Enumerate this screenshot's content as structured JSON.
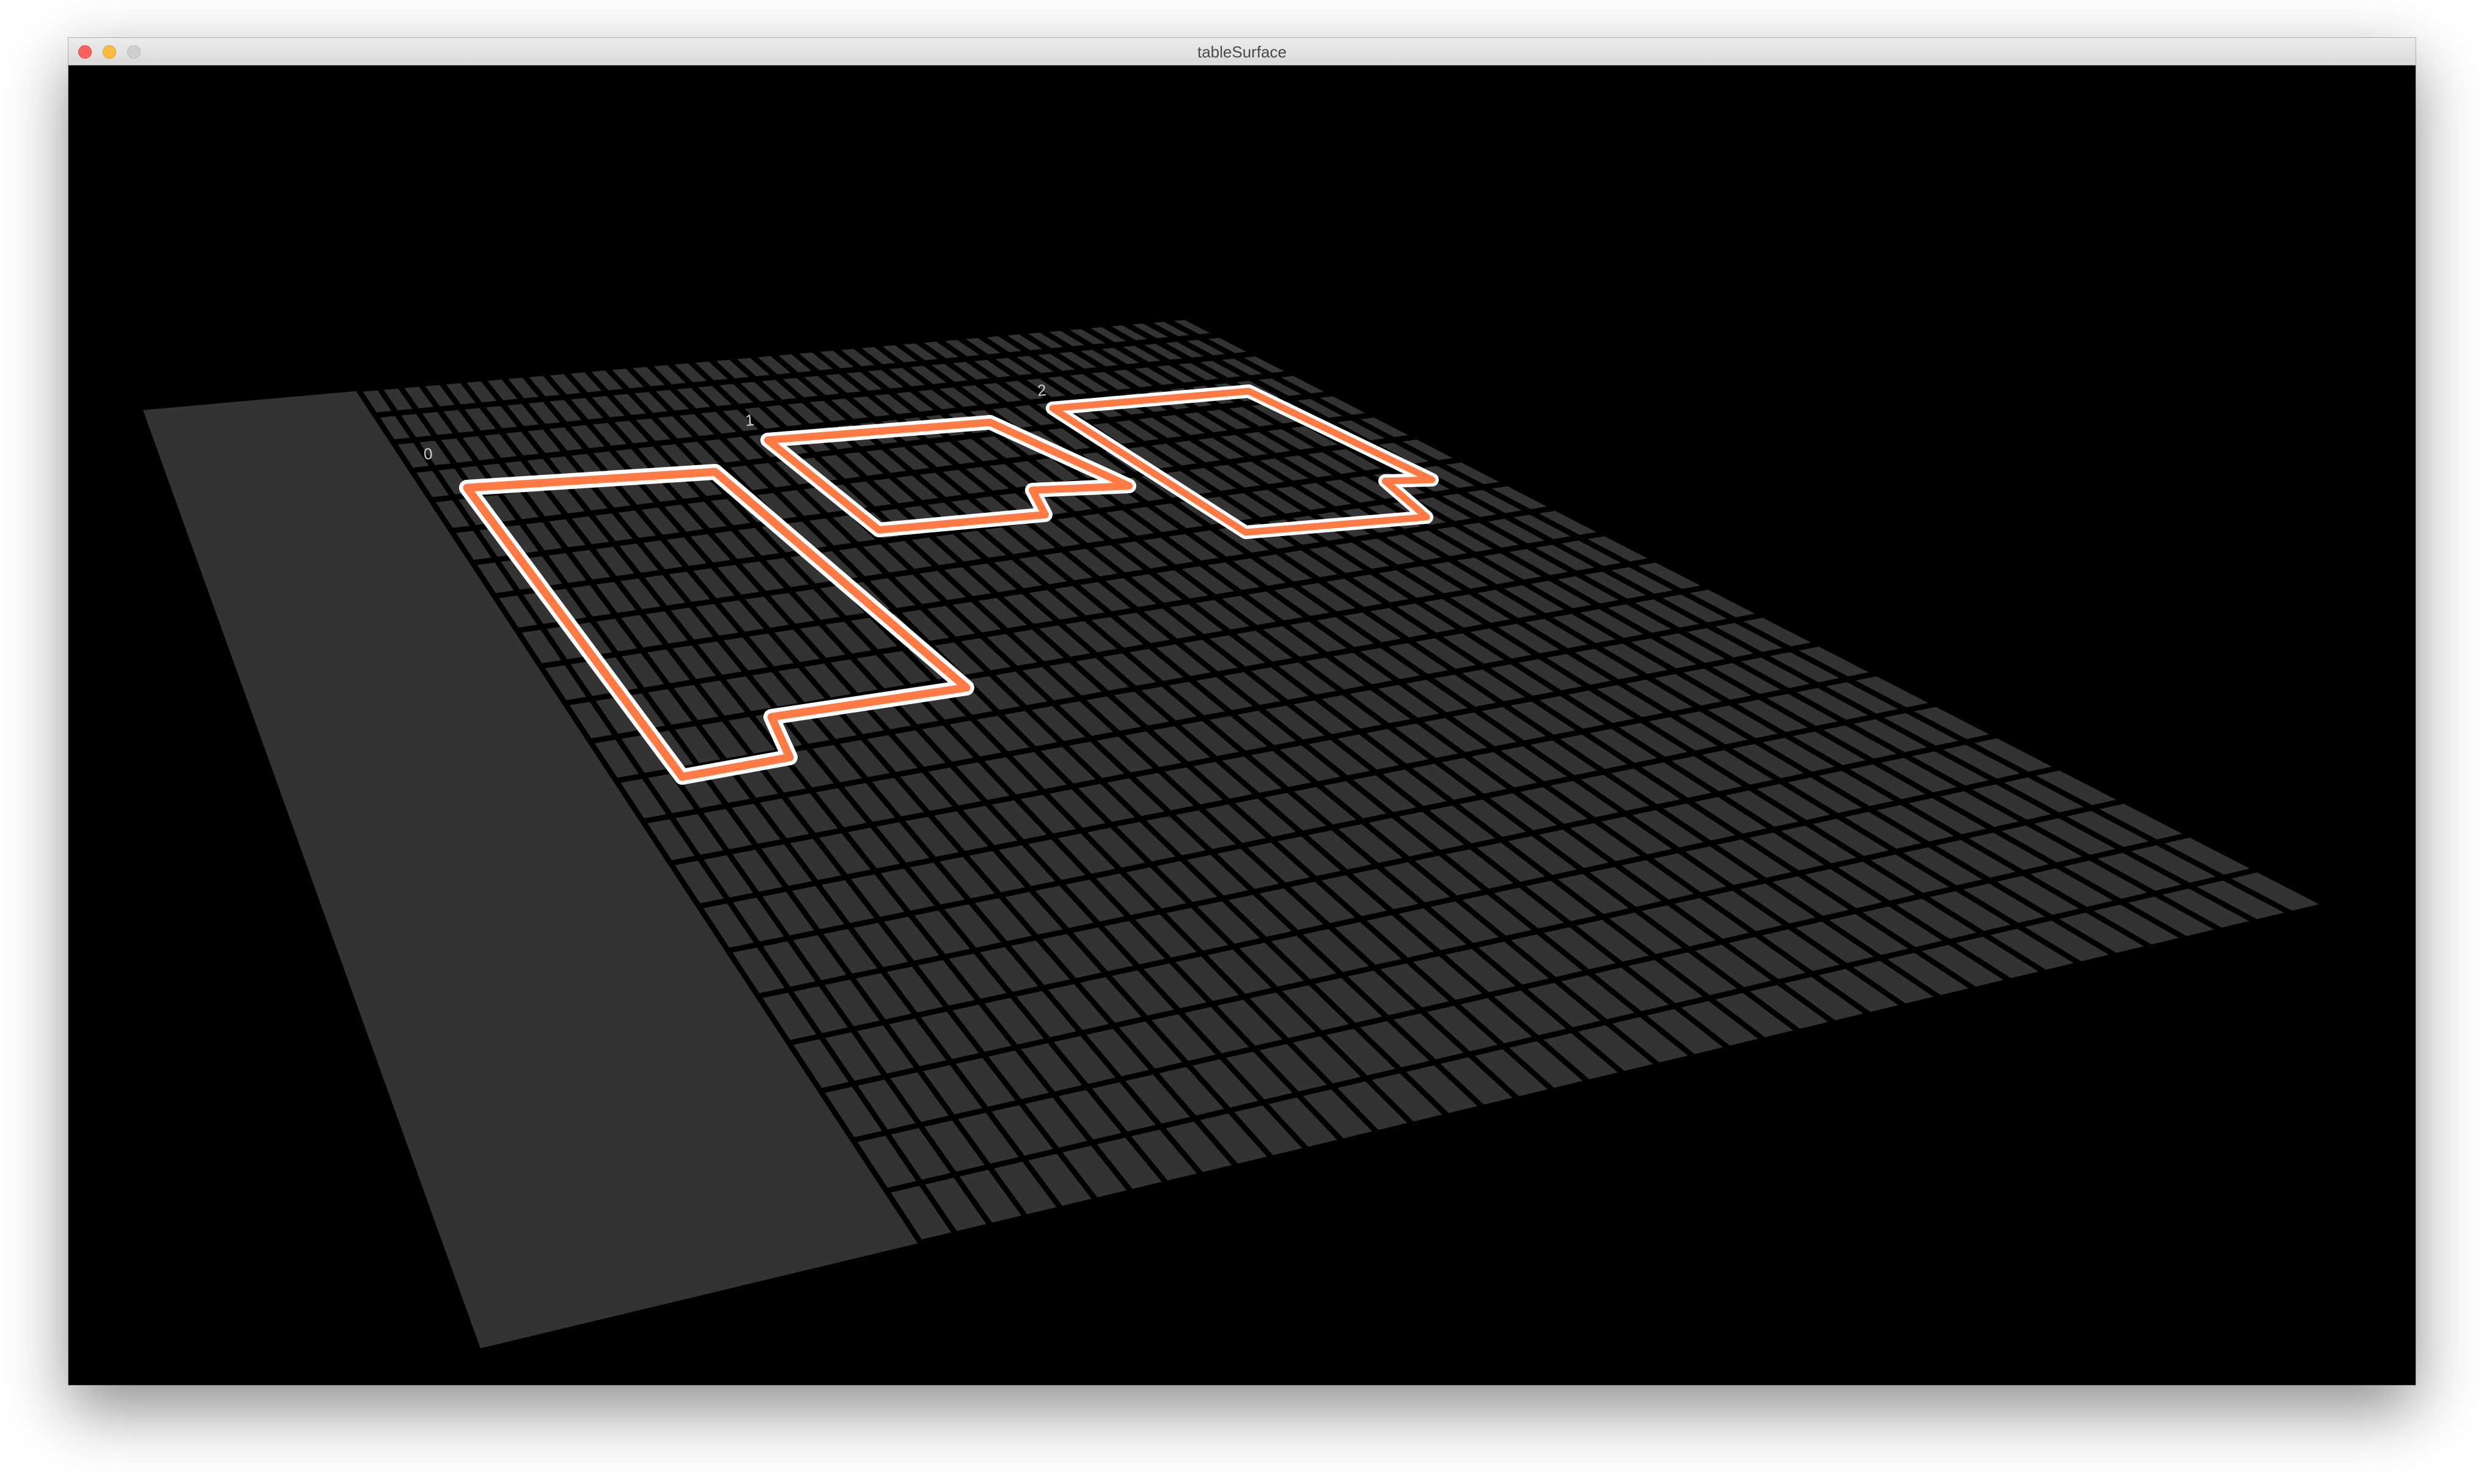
{
  "window": {
    "title": "tableSurface"
  },
  "scene": {
    "background": "#000000",
    "table_color": "#333333",
    "grid_line_color": "#000000",
    "outline_color": "#ff7a45",
    "outline_edge_color": "#ffffff",
    "labels": [
      "0",
      "1",
      "2"
    ]
  }
}
